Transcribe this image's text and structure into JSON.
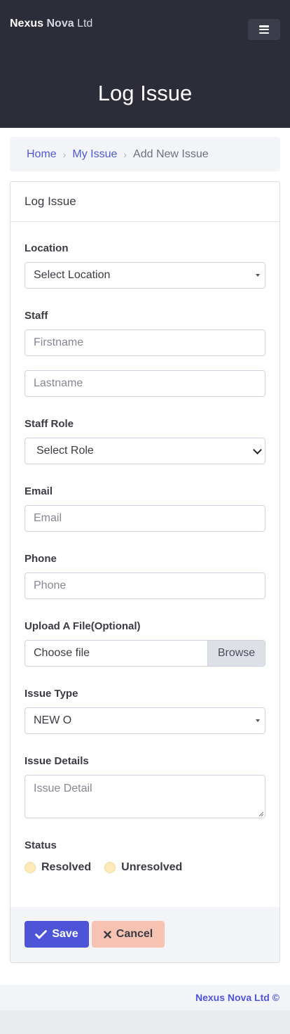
{
  "brand": {
    "part1": "Nexus",
    "part2": "Nova",
    "part3": "Ltd"
  },
  "header": {
    "title": "Log Issue",
    "menu_icon": "hamburger-icon"
  },
  "breadcrumb": {
    "home": "Home",
    "section": "My Issue",
    "current": "Add New Issue"
  },
  "card": {
    "title": "Log Issue"
  },
  "form": {
    "location": {
      "label": "Location",
      "value": "Select Location"
    },
    "staff": {
      "label": "Staff",
      "firstname_placeholder": "Firstname",
      "lastname_placeholder": "Lastname"
    },
    "staff_role": {
      "label": "Staff Role",
      "value": "Select Role"
    },
    "email": {
      "label": "Email",
      "placeholder": "Email"
    },
    "phone": {
      "label": "Phone",
      "placeholder": "Phone"
    },
    "upload": {
      "label": "Upload A File(Optional)",
      "value": "Choose file",
      "browse": "Browse"
    },
    "issue_type": {
      "label": "Issue Type",
      "value": "NEW O"
    },
    "issue_details": {
      "label": "Issue Details",
      "placeholder": "Issue Detail"
    },
    "status": {
      "label": "Status",
      "options": [
        "Resolved",
        "Unresolved"
      ]
    }
  },
  "actions": {
    "save": "Save",
    "cancel": "Cancel"
  },
  "footer": {
    "text": "Nexus Nova Ltd ©"
  },
  "colors": {
    "header_bg": "#2d2d3a",
    "primary": "#4e54d8",
    "cancel": "#f7c2b1",
    "radio": "#fde9b9"
  }
}
